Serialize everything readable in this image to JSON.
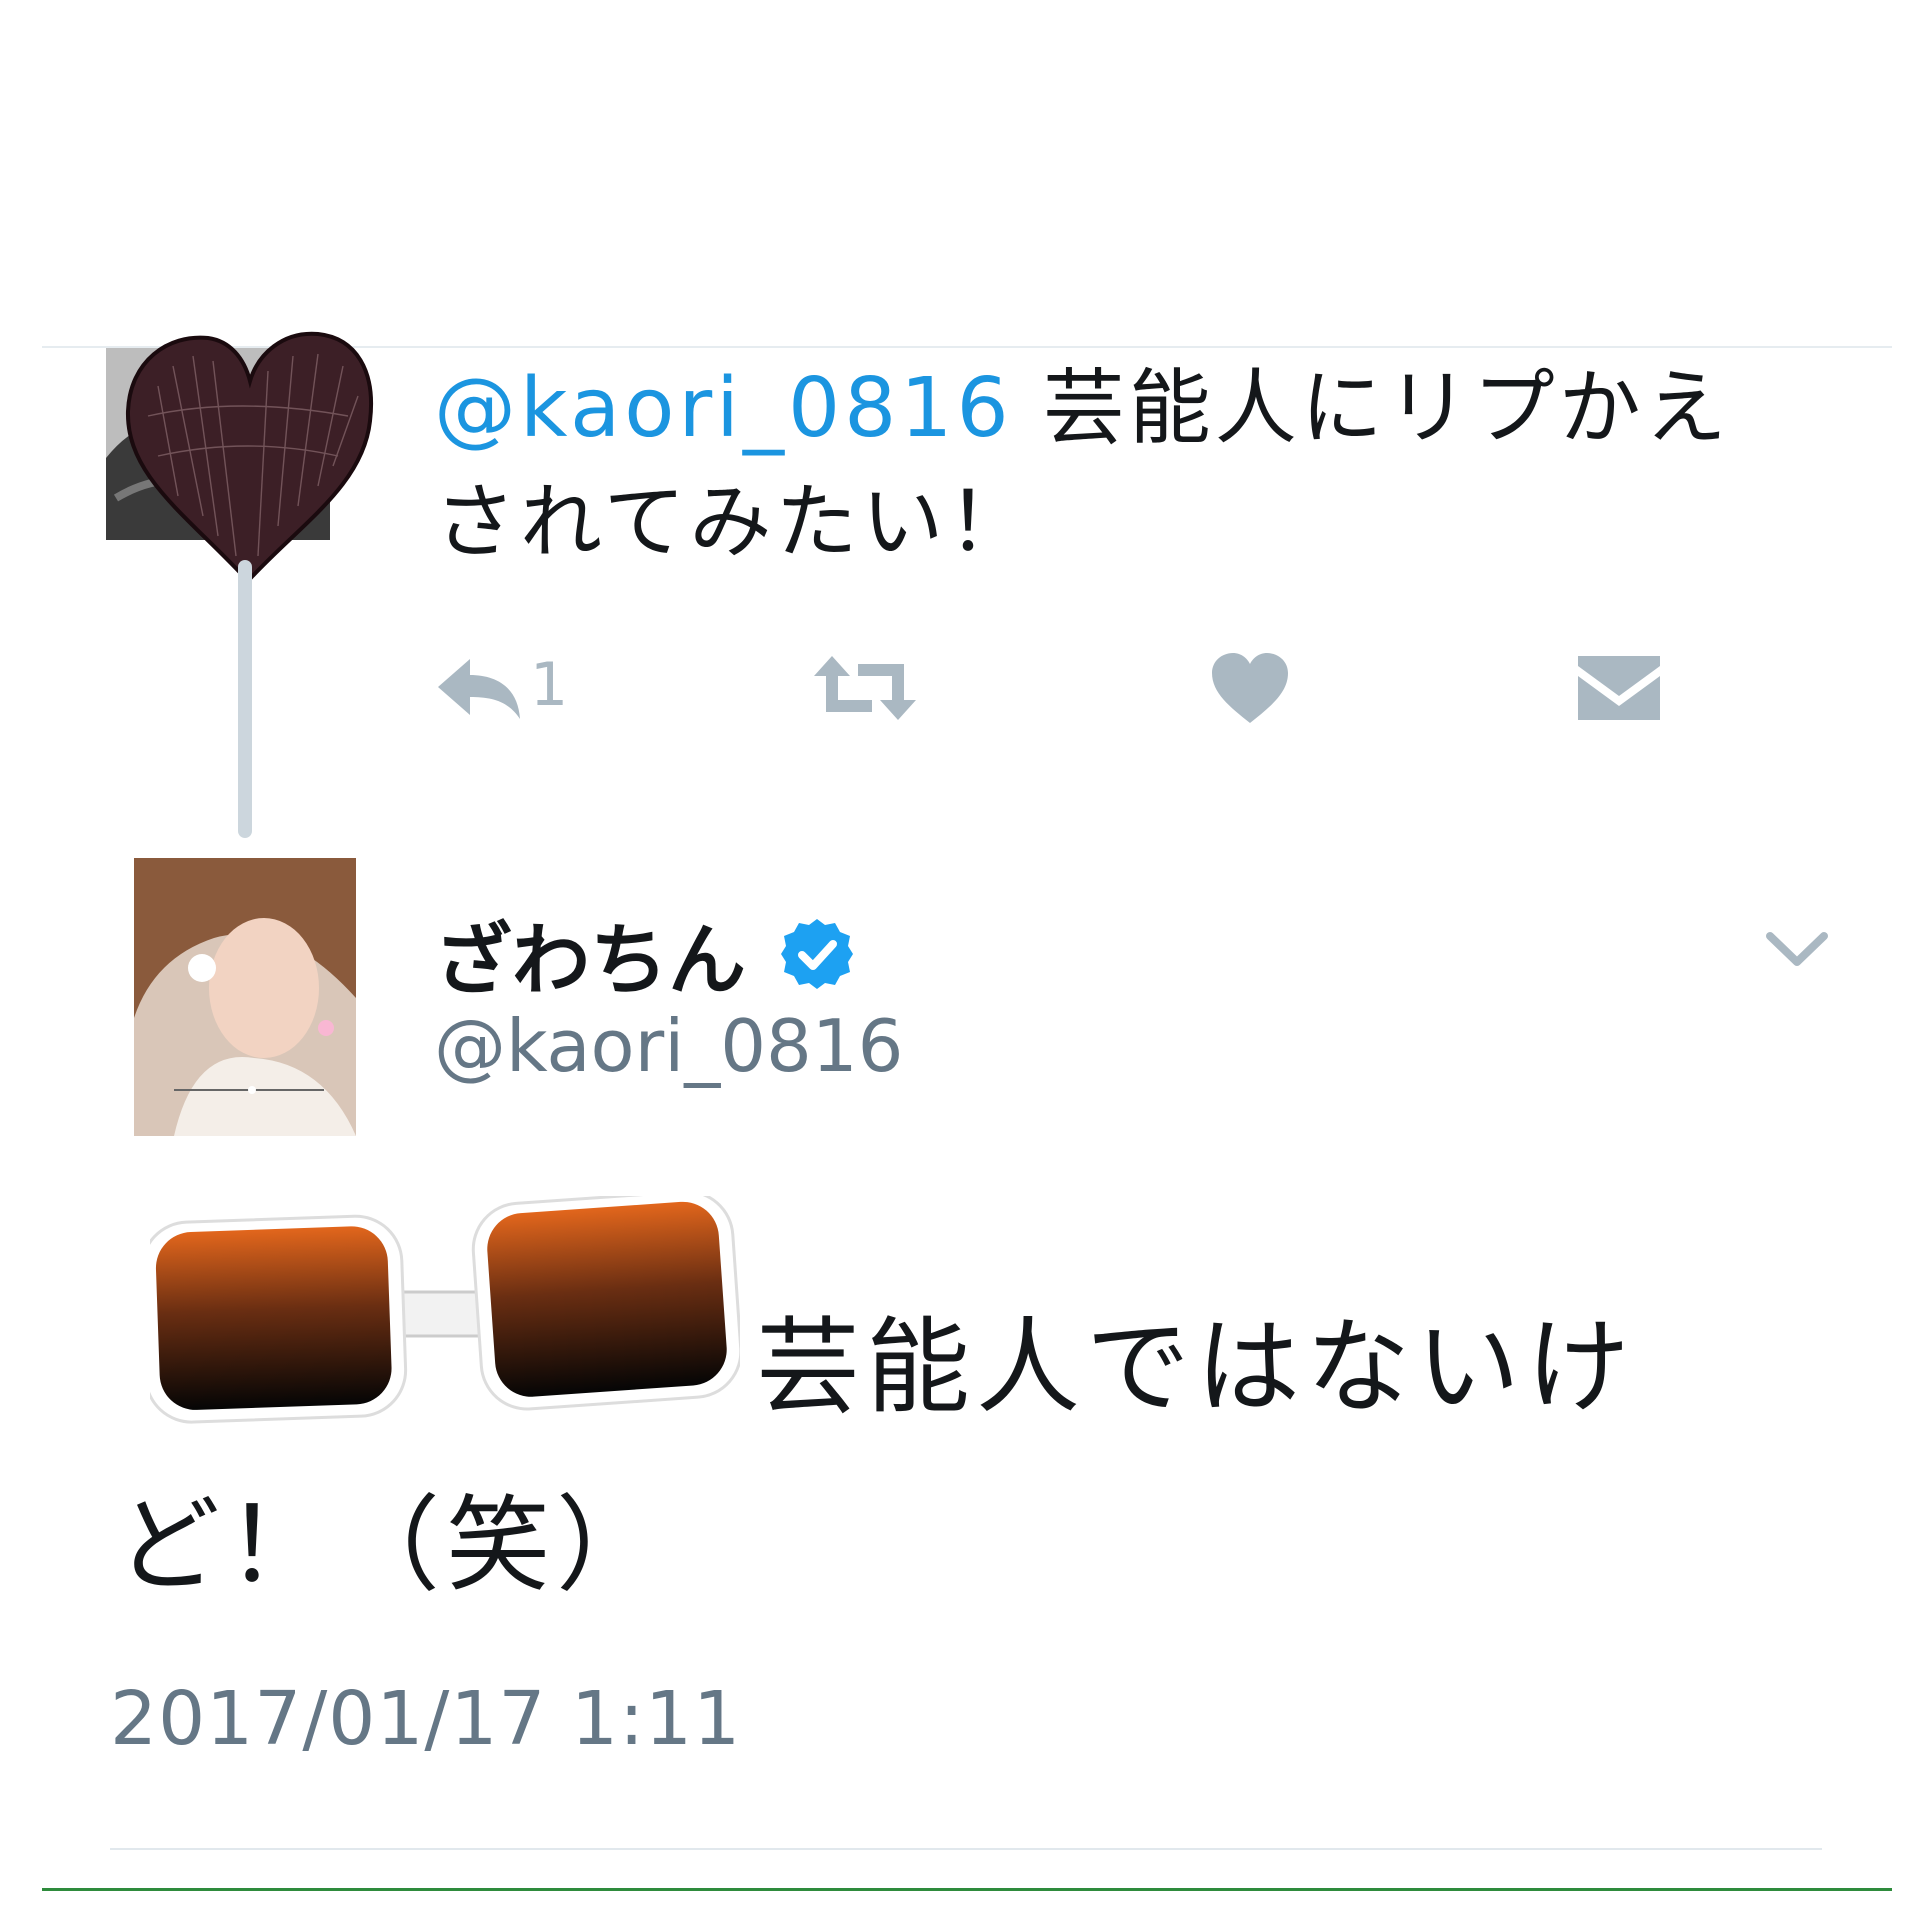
{
  "parent_tweet": {
    "mention": "@kaori_0816",
    "text": " 芸能人にリプかえされてみたい！",
    "reply_count": "1"
  },
  "reply_tweet": {
    "display_name": "ざわちん",
    "screen_name": "@kaori_0816",
    "text": "芸能人ではないけど！（笑）",
    "timestamp": "2017/01/17 1:11"
  },
  "colors": {
    "mention": "#1b95e0",
    "verified": "#1da1f2",
    "action_icon": "#aab8c2",
    "secondary_text": "#657786",
    "heart_sticker": "#3c1f26"
  },
  "icons": {
    "reply": "reply-icon",
    "retweet": "retweet-icon",
    "like": "heart-icon",
    "dm": "envelope-icon",
    "verified": "verified-badge-icon",
    "menu": "chevron-down-icon"
  }
}
